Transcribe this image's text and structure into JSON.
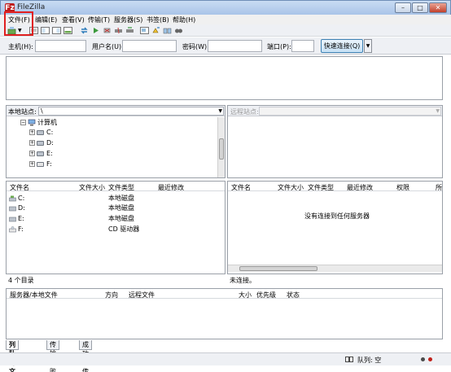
{
  "window": {
    "title": "FileZilla",
    "logo": "Fz",
    "min": "–",
    "max": "□",
    "close": "✕"
  },
  "menu": [
    "文件(F)",
    "编辑(E)",
    "查看(V)",
    "传输(T)",
    "服务器(S)",
    "书签(B)",
    "帮助(H)"
  ],
  "quickconnect": {
    "host_label": "主机(H):",
    "host_value": "",
    "user_label": "用户名(U):",
    "user_value": "",
    "pass_label": "密码(W):",
    "pass_value": "",
    "port_label": "端口(P):",
    "port_value": "",
    "connect_label": "快速连接(Q)"
  },
  "local": {
    "site_label": "本地站点:",
    "path": "\\",
    "tree": {
      "root": "计算机",
      "drives": [
        "C:",
        "D:",
        "E:",
        "F:"
      ]
    },
    "columns": [
      "文件名",
      "文件大小",
      "文件类型",
      "最近修改"
    ],
    "files": [
      {
        "name": "C:",
        "type": "本地磁盘"
      },
      {
        "name": "D:",
        "type": "本地磁盘"
      },
      {
        "name": "E:",
        "type": "本地磁盘"
      },
      {
        "name": "F:",
        "type": "CD 驱动器"
      }
    ],
    "status": "4 个目录"
  },
  "remote": {
    "site_label": "远程站点:",
    "path": "",
    "columns": [
      "文件名",
      "文件大小",
      "文件类型",
      "最近修改",
      "权限",
      "所"
    ],
    "empty_message": "没有连接到任何服务器",
    "status": "未连接。"
  },
  "queue": {
    "columns": [
      "服务器/本地文件",
      "方向",
      "远程文件",
      "大小",
      "优先级",
      "状态"
    ]
  },
  "tabs": [
    "列队的文件",
    "传输失败",
    "成功的传输"
  ],
  "statusbar": {
    "queue": "队列: 空"
  },
  "colors": {
    "highlight_box": "#e02020",
    "titlebar": "#a9c4e8",
    "connect_button": "#c7e1f5"
  }
}
